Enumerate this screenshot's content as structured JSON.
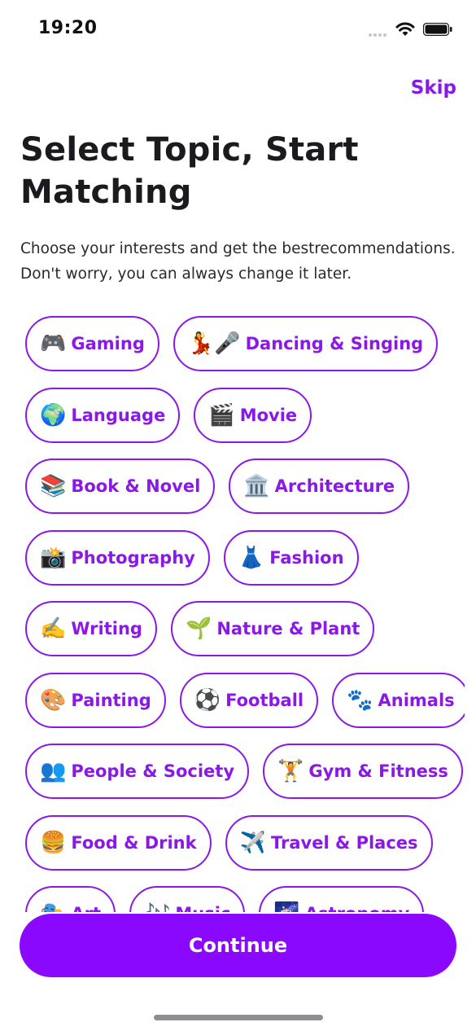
{
  "status_bar": {
    "time": "19:20"
  },
  "header": {
    "skip_label": "Skip"
  },
  "title": "Select Topic, Start Matching",
  "subtitle_lines": [
    "Choose your interests and get the bestrecommendations.",
    "Don't worry, you can always change it later."
  ],
  "topics": [
    {
      "emoji": "🎮",
      "label": "Gaming"
    },
    {
      "emoji": "💃🎤",
      "label": "Dancing & Singing"
    },
    {
      "emoji": "🌍",
      "label": "Language"
    },
    {
      "emoji": "🎬",
      "label": "Movie"
    },
    {
      "emoji": "📚",
      "label": "Book & Novel"
    },
    {
      "emoji": "🏛️",
      "label": "Architecture"
    },
    {
      "emoji": "📸",
      "label": "Photography"
    },
    {
      "emoji": "👗",
      "label": "Fashion"
    },
    {
      "emoji": "✍️",
      "label": "Writing"
    },
    {
      "emoji": "🌱",
      "label": "Nature & Plant"
    },
    {
      "emoji": "🎨",
      "label": "Painting"
    },
    {
      "emoji": "⚽",
      "label": "Football"
    },
    {
      "emoji": "🐾",
      "label": "Animals"
    },
    {
      "emoji": "👥",
      "label": "People & Society"
    },
    {
      "emoji": "🏋️",
      "label": "Gym & Fitness"
    },
    {
      "emoji": "🍔",
      "label": "Food & Drink"
    },
    {
      "emoji": "✈️",
      "label": "Travel & Places"
    },
    {
      "emoji": "🎭",
      "label": "Art"
    },
    {
      "emoji": "🎶",
      "label": "Music"
    },
    {
      "emoji": "🌌",
      "label": "Astronomy"
    }
  ],
  "continue_label": "Continue",
  "accent_color": "#8a18e6",
  "button_color": "#8b08ff"
}
